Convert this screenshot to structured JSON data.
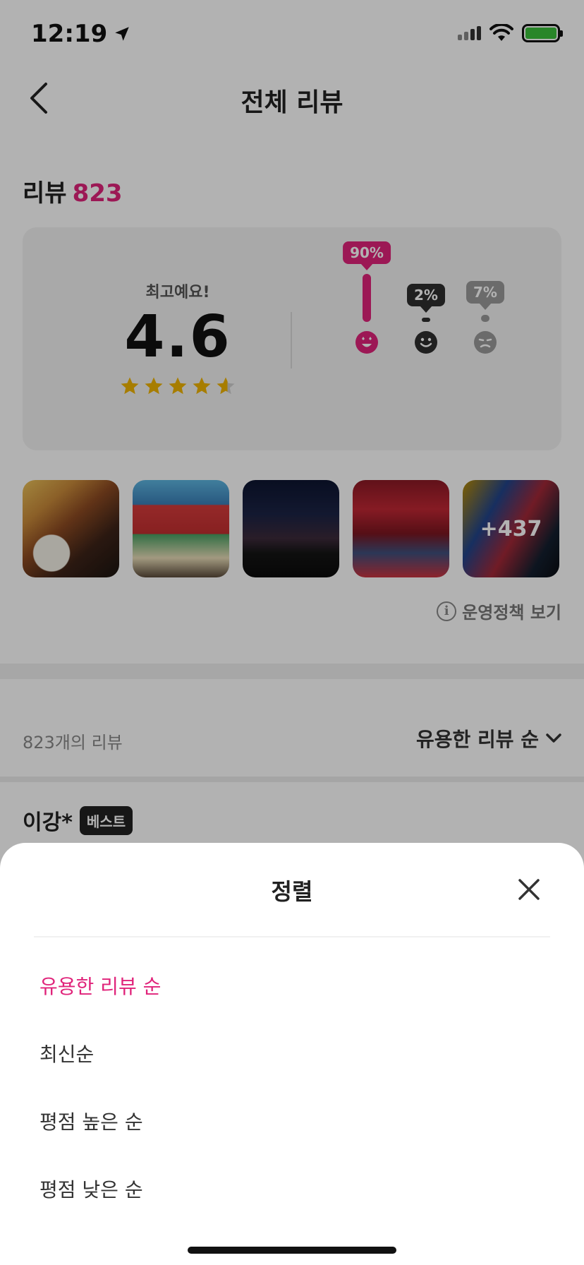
{
  "status_bar": {
    "time": "12:19"
  },
  "nav": {
    "title": "전체 리뷰"
  },
  "review_heading": {
    "label": "리뷰",
    "count": "823"
  },
  "rating": {
    "label": "최고예요!",
    "score": "4.6",
    "stars_value": 4.6,
    "distribution": [
      {
        "percent": "90%",
        "value": 0.9,
        "color": "#e0237a",
        "face": "love-face-icon"
      },
      {
        "percent": "2%",
        "value": 0.02,
        "color": "#2f2f2f",
        "face": "smile-face-icon"
      },
      {
        "percent": "7%",
        "value": 0.07,
        "color": "#9a9a9a",
        "face": "sad-face-icon"
      }
    ]
  },
  "photos": {
    "more_count": "+437"
  },
  "policy_link": {
    "label": "운영정책 보기"
  },
  "list": {
    "review_count": "823개의 리뷰",
    "sort_label": "유용한 리뷰 순"
  },
  "first_review": {
    "name": "이강*",
    "badge": "베스트"
  },
  "sheet": {
    "title": "정렬",
    "options": [
      "유용한 리뷰 순",
      "최신순",
      "평점 높은 순",
      "평점 낮은 순"
    ],
    "active_index": 0
  },
  "colors": {
    "accent": "#e0237a",
    "star": "#f0b400"
  }
}
